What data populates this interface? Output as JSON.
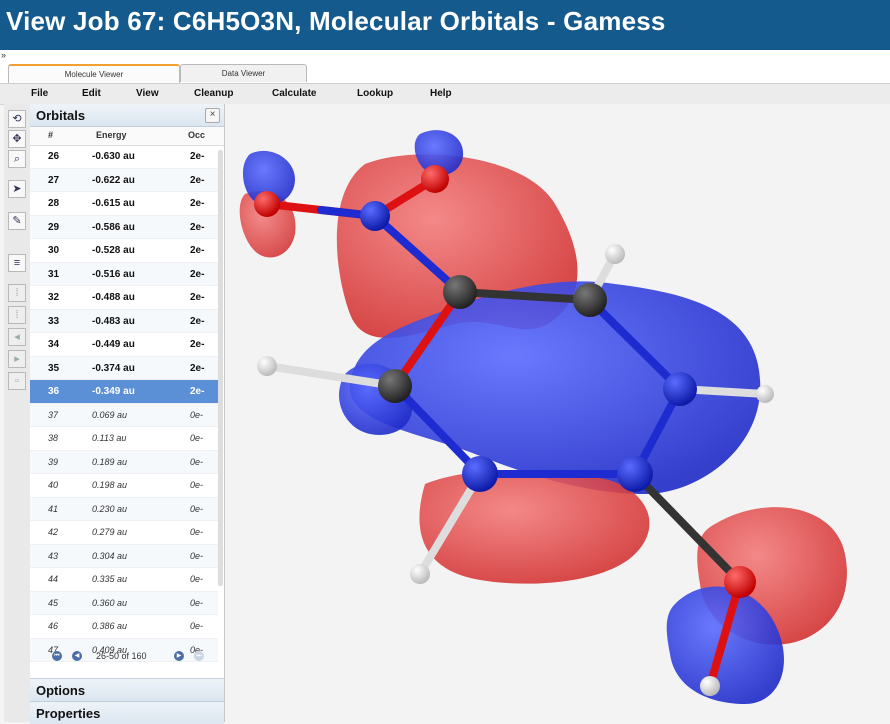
{
  "window": {
    "title": "View Job 67: C6H5O3N, Molecular Orbitals - Gamess"
  },
  "tabs": [
    {
      "label": "Molecule Viewer"
    },
    {
      "label": "Data Viewer"
    }
  ],
  "menu": [
    "File",
    "Edit",
    "View",
    "Cleanup",
    "Calculate",
    "Lookup",
    "Help"
  ],
  "toolbar": {
    "icons": [
      "rotate-icon",
      "move-icon",
      "zoom-icon",
      "select-arrow-icon",
      "edit-icon",
      "list-icon",
      "tool-a-icon",
      "tool-b-icon",
      "tool-c-icon",
      "tool-d-icon",
      "tool-e-icon"
    ]
  },
  "orbitals": {
    "title": "Orbitals",
    "close": "×",
    "columns": {
      "number": "#",
      "energy": "Energy",
      "occ": "Occ"
    },
    "rows": [
      {
        "n": "26",
        "e": "-0.630 au",
        "o": "2e-"
      },
      {
        "n": "27",
        "e": "-0.622 au",
        "o": "2e-"
      },
      {
        "n": "28",
        "e": "-0.615 au",
        "o": "2e-"
      },
      {
        "n": "29",
        "e": "-0.586 au",
        "o": "2e-"
      },
      {
        "n": "30",
        "e": "-0.528 au",
        "o": "2e-"
      },
      {
        "n": "31",
        "e": "-0.516 au",
        "o": "2e-"
      },
      {
        "n": "32",
        "e": "-0.488 au",
        "o": "2e-"
      },
      {
        "n": "33",
        "e": "-0.483 au",
        "o": "2e-"
      },
      {
        "n": "34",
        "e": "-0.449 au",
        "o": "2e-"
      },
      {
        "n": "35",
        "e": "-0.374 au",
        "o": "2e-"
      },
      {
        "n": "36",
        "e": "-0.349 au",
        "o": "2e-"
      },
      {
        "n": "37",
        "e": "0.069 au",
        "o": "0e-"
      },
      {
        "n": "38",
        "e": "0.113 au",
        "o": "0e-"
      },
      {
        "n": "39",
        "e": "0.189 au",
        "o": "0e-"
      },
      {
        "n": "40",
        "e": "0.198 au",
        "o": "0e-"
      },
      {
        "n": "41",
        "e": "0.230 au",
        "o": "0e-"
      },
      {
        "n": "42",
        "e": "0.279 au",
        "o": "0e-"
      },
      {
        "n": "43",
        "e": "0.304 au",
        "o": "0e-"
      },
      {
        "n": "44",
        "e": "0.335 au",
        "o": "0e-"
      },
      {
        "n": "45",
        "e": "0.360 au",
        "o": "0e-"
      },
      {
        "n": "46",
        "e": "0.386 au",
        "o": "0e-"
      },
      {
        "n": "47",
        "e": "0.409 au",
        "o": "0e-"
      }
    ],
    "selected": "36",
    "pager": {
      "text": "26-50 of 160"
    }
  },
  "sections": {
    "options": "Options",
    "properties": "Properties"
  },
  "colors": {
    "positive_lobe": "#e03a3a",
    "negative_lobe": "#2b3bd6",
    "title_bar": "#145a8c",
    "selection": "#5b8fd6"
  }
}
